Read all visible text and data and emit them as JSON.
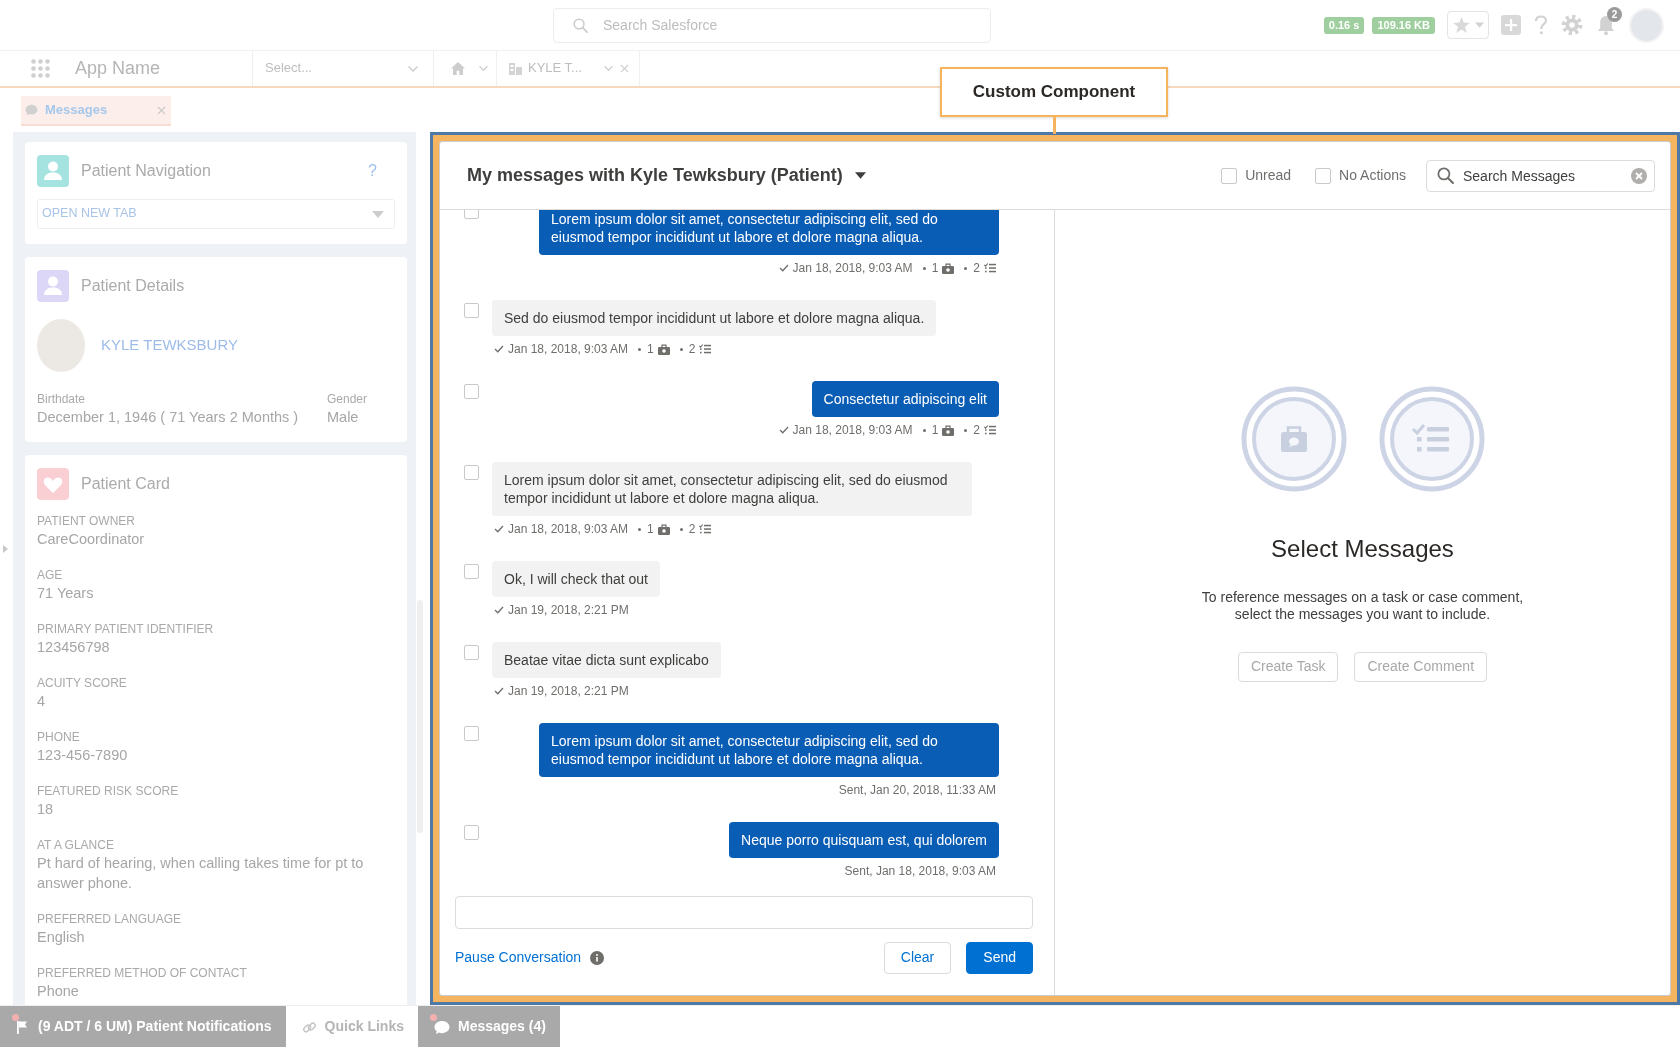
{
  "global_header": {
    "search": {
      "placeholder": "Search Salesforce"
    },
    "perf_badges": [
      "0.16 s",
      "109.16 KB"
    ],
    "notification_count": "2"
  },
  "nav_bar": {
    "app_name": "App Name",
    "object_select": {
      "placeholder": "Select..."
    },
    "tabs": [
      {
        "label": "KYLE T...",
        "selected": true
      }
    ]
  },
  "subtabs": [
    {
      "label": "Messages",
      "selected": true
    }
  ],
  "callout": {
    "label": "Custom Component"
  },
  "sidebar": {
    "cards": [
      {
        "kind": "navigation",
        "title": "Patient Navigation",
        "help": "?",
        "select": {
          "value": "OPEN NEW TAB"
        }
      },
      {
        "kind": "details",
        "title": "Patient Details",
        "name": "KYLE TEWKSBURY",
        "fields": [
          {
            "label": "Birthdate",
            "value": "December 1, 1946 ( 71 Years 2 Months )"
          },
          {
            "label": "Gender",
            "value": "Male"
          }
        ]
      },
      {
        "kind": "card",
        "title": "Patient Card",
        "fields": [
          {
            "label": "PATIENT OWNER",
            "value": "CareCoordinator"
          },
          {
            "label": "AGE",
            "value": "71 Years"
          },
          {
            "label": "PRIMARY PATIENT IDENTIFIER",
            "value": "123456798"
          },
          {
            "label": "ACUITY SCORE",
            "value": "4"
          },
          {
            "label": "PHONE",
            "value": "123-456-7890"
          },
          {
            "label": "FEATURED RISK SCORE",
            "value": "18"
          },
          {
            "label": "AT A GLANCE",
            "value": "Pt hard of hearing, when calling takes time for pt to answer phone."
          },
          {
            "label": "PREFERRED LANGUAGE",
            "value": "English"
          },
          {
            "label": "PREFERRED METHOD OF CONTACT",
            "value": "Phone"
          }
        ]
      }
    ]
  },
  "messages_panel": {
    "title": "My messages with Kyle Tewksbury (Patient)",
    "filters": [
      {
        "label": "Unread",
        "checked": false
      },
      {
        "label": "No Actions",
        "checked": false
      }
    ],
    "search": {
      "value": "Search Messages"
    },
    "messages": [
      {
        "kind": "outgoing",
        "checked": false,
        "text": "Lorem ipsum dolor sit amet, consectetur adipiscing elit, sed do eiusmod tempor incididunt ut labore et dolore magna aliqua.",
        "read": true,
        "time": "Jan 18, 2018, 9:03 AM",
        "case_count": "1",
        "task_count": "2"
      },
      {
        "kind": "incoming",
        "checked": false,
        "text": "Sed do eiusmod tempor incididunt ut labore et dolore magna aliqua.",
        "read": true,
        "time": "Jan 18, 2018, 9:03 AM",
        "case_count": "1",
        "task_count": "2"
      },
      {
        "kind": "outgoing",
        "checked": false,
        "text": "Consectetur adipiscing elit",
        "read": true,
        "time": "Jan 18, 2018, 9:03 AM",
        "case_count": "1",
        "task_count": "2"
      },
      {
        "kind": "incoming",
        "checked": false,
        "text": "Lorem ipsum dolor sit amet, consectetur adipiscing elit, sed do eiusmod tempor incididunt ut labore et dolore magna aliqua.",
        "read": true,
        "time": "Jan 18, 2018, 9:03 AM",
        "case_count": "1",
        "task_count": "2"
      },
      {
        "kind": "incoming",
        "checked": false,
        "text": "Ok, I will check that out",
        "read": true,
        "time": "Jan 19, 2018, 2:21 PM"
      },
      {
        "kind": "incoming",
        "checked": false,
        "text": "Beatae vitae dicta sunt explicabo",
        "read": true,
        "time": "Jan 19, 2018, 2:21 PM"
      },
      {
        "kind": "outgoing",
        "checked": false,
        "text": "Lorem ipsum dolor sit amet, consectetur adipiscing elit, sed do eiusmod tempor incididunt ut labore et dolore magna aliqua.",
        "read": false,
        "time": "Sent, Jan 20, 2018, 11:33 AM"
      },
      {
        "kind": "outgoing",
        "checked": false,
        "text": "Neque porro quisquam est, qui dolorem",
        "read": false,
        "time": "Sent, Jan 18, 2018, 9:03 AM"
      }
    ],
    "composer": {
      "pause_link": "Pause Conversation",
      "buttons": [
        {
          "label": "Clear",
          "kind": "neutral"
        },
        {
          "label": "Send",
          "kind": "brand"
        }
      ]
    }
  },
  "empty_state": {
    "title": "Select Messages",
    "text": "To reference messages on a task or case comment, select the messages you want to include.",
    "buttons": [
      {
        "label": "Create Task",
        "disabled": true
      },
      {
        "label": "Create Comment",
        "disabled": true
      }
    ]
  },
  "utility_bar": [
    {
      "kind": "notifications",
      "label": "(9 ADT / 6 UM) Patient Notifications",
      "unread": true
    },
    {
      "kind": "links",
      "label": "Quick Links",
      "unread": false
    },
    {
      "kind": "messages",
      "label": "Messages (4)",
      "unread": true
    }
  ]
}
